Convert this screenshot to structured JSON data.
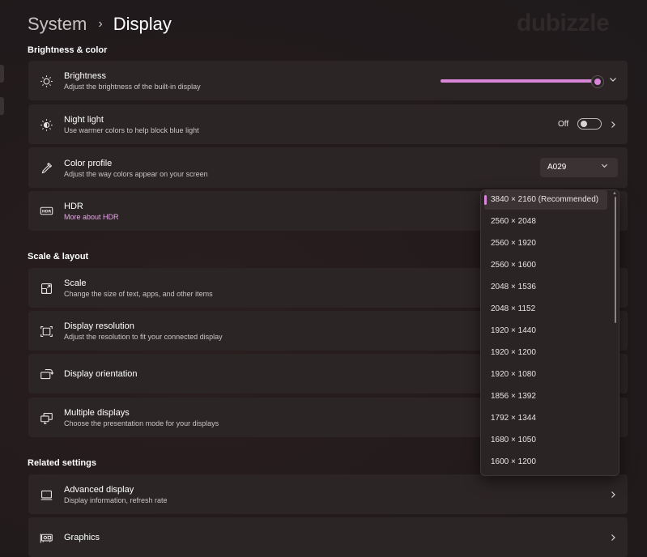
{
  "breadcrumb": {
    "parent": "System",
    "separator": "›",
    "current": "Display"
  },
  "watermark": "dubizzle",
  "sections": {
    "brightness_color": "Brightness & color",
    "scale_layout": "Scale & layout",
    "related_settings": "Related settings"
  },
  "brightness": {
    "title": "Brightness",
    "subtitle": "Adjust the brightness of the built-in display",
    "level_percent": 100,
    "icon": "sun-icon"
  },
  "night_light": {
    "title": "Night light",
    "subtitle": "Use warmer colors to help block blue light",
    "toggle_label": "Off",
    "state": false,
    "icon": "night-light-icon"
  },
  "color_profile": {
    "title": "Color profile",
    "subtitle": "Adjust the way colors appear on your screen",
    "value": "A029",
    "icon": "eyedropper-icon"
  },
  "hdr": {
    "title": "HDR",
    "link": "More about HDR",
    "icon": "hdr-icon"
  },
  "scale": {
    "title": "Scale",
    "subtitle": "Change the size of text, apps, and other items",
    "icon": "scale-icon"
  },
  "display_resolution": {
    "title": "Display resolution",
    "subtitle": "Adjust the resolution to fit your connected display",
    "icon": "resolution-icon"
  },
  "display_orientation": {
    "title": "Display orientation",
    "icon": "orientation-icon"
  },
  "multiple_displays": {
    "title": "Multiple displays",
    "subtitle": "Choose the presentation mode for your displays",
    "icon": "multiple-displays-icon"
  },
  "advanced_display": {
    "title": "Advanced display",
    "subtitle": "Display information, refresh rate",
    "icon": "monitor-icon"
  },
  "graphics": {
    "title": "Graphics",
    "icon": "graphics-card-icon"
  },
  "resolution_dropdown": {
    "selected_index": 0,
    "options": [
      "3840 × 2160 (Recommended)",
      "2560 × 2048",
      "2560 × 1920",
      "2560 × 1600",
      "2048 × 1536",
      "2048 × 1152",
      "1920 × 1440",
      "1920 × 1200",
      "1920 × 1080",
      "1856 × 1392",
      "1792 × 1344",
      "1680 × 1050",
      "1600 × 1200"
    ]
  },
  "colors": {
    "accent": "#d986d9",
    "link": "#e7a8e8",
    "card": "#2c2526",
    "background": "#231b1c"
  }
}
